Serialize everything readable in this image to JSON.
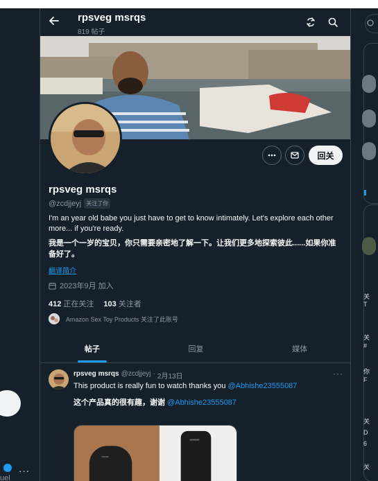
{
  "header": {
    "name": "rpsveg msrqs",
    "post_count": "819 帖子"
  },
  "profile": {
    "name": "rpsveg msrqs",
    "handle": "@zcdjjeyj",
    "follows_you": "关注了你",
    "bio_en": "I'm an  year old babe you just have to get to know intimately. Let's explore each other more... if you're ready.",
    "bio_zh": "我是一个一岁的宝贝，你只需要亲密地了解一下。让我们更多地探索彼此......如果你准备好了。",
    "translate_label": "翻译简介",
    "joined": "2023年9月 加入",
    "following_count": "412",
    "following_label": "正在关注",
    "followers_count": "103",
    "followers_label": "关注者",
    "followed_by": "Amazon Sex Toy Products 关注了此账号"
  },
  "actions": {
    "follow_label": "回关"
  },
  "tabs": [
    {
      "label": "帖子",
      "active": true
    },
    {
      "label": "回复",
      "active": false
    },
    {
      "label": "媒体",
      "active": false
    }
  ],
  "post": {
    "name": "rpsveg msrqs",
    "handle": "@zcdjjeyj",
    "separator": "·",
    "date": "2月13日",
    "text_en": "This product is really fun to watch thanks you ",
    "mention": "@Abhishe23555087",
    "text_zh": "这个产品真的很有趣，谢谢 ",
    "more": "···"
  },
  "sidebar_left": {
    "fragment": "uel",
    "more": "···"
  },
  "sidebar_right": {
    "glyphs": [
      "关",
      "T",
      "关",
      "#",
      "你",
      "F",
      "关",
      "D",
      "6",
      "关"
    ]
  },
  "colors": {
    "background": "#15202b",
    "accent": "#1d9bf0",
    "border": "#38444d",
    "text_secondary": "#8b98a5"
  },
  "icons": {
    "back": "arrow-left-icon",
    "refresh": "refresh-icon",
    "search": "search-icon",
    "more": "more-icon",
    "message": "envelope-icon",
    "calendar": "calendar-icon"
  }
}
